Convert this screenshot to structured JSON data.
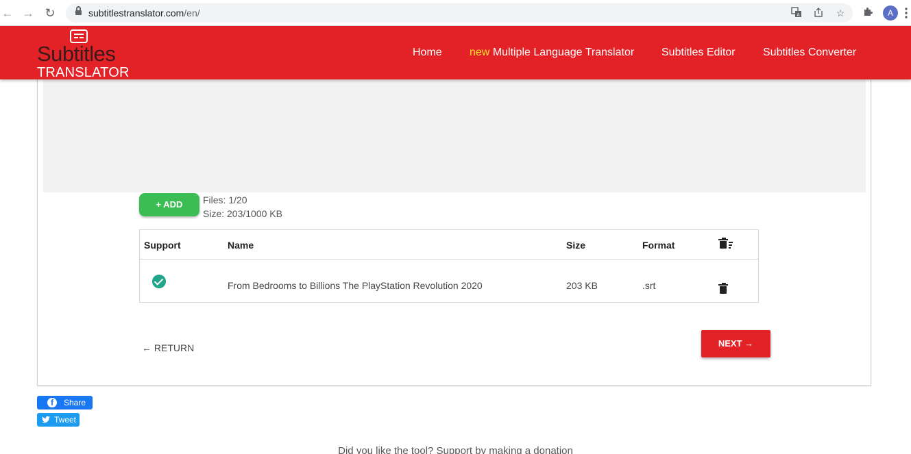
{
  "browser": {
    "url_host": "subtitlestranslator.com",
    "url_path": "/en/",
    "profile_initial": "A"
  },
  "header": {
    "logo_line1": "Subtitles",
    "logo_line2": "TRANSLATOR",
    "nav": {
      "home": "Home",
      "new_badge": "new",
      "multi": "Multiple Language Translator",
      "editor": "Subtitles Editor",
      "converter": "Subtitles Converter"
    },
    "colors": {
      "brand": "#e32227",
      "badge": "#ffe033"
    }
  },
  "upload": {
    "add_label": "+ ADD",
    "files_count": "Files: 1/20",
    "size_info": "Size: 203/1000 KB"
  },
  "table": {
    "headers": {
      "support": "Support",
      "name": "Name",
      "size": "Size",
      "format": "Format"
    },
    "rows": [
      {
        "name": "From Bedrooms to Billions The PlayStation Revolution 2020",
        "size": "203 KB",
        "format": ".srt",
        "supported": true
      }
    ]
  },
  "actions": {
    "return_label": "RETURN",
    "next_label": "NEXT"
  },
  "social": {
    "share_label": "Share",
    "tweet_label": "Tweet"
  },
  "footer": {
    "donation_text": "Did you like the tool? Support by making a donation"
  }
}
